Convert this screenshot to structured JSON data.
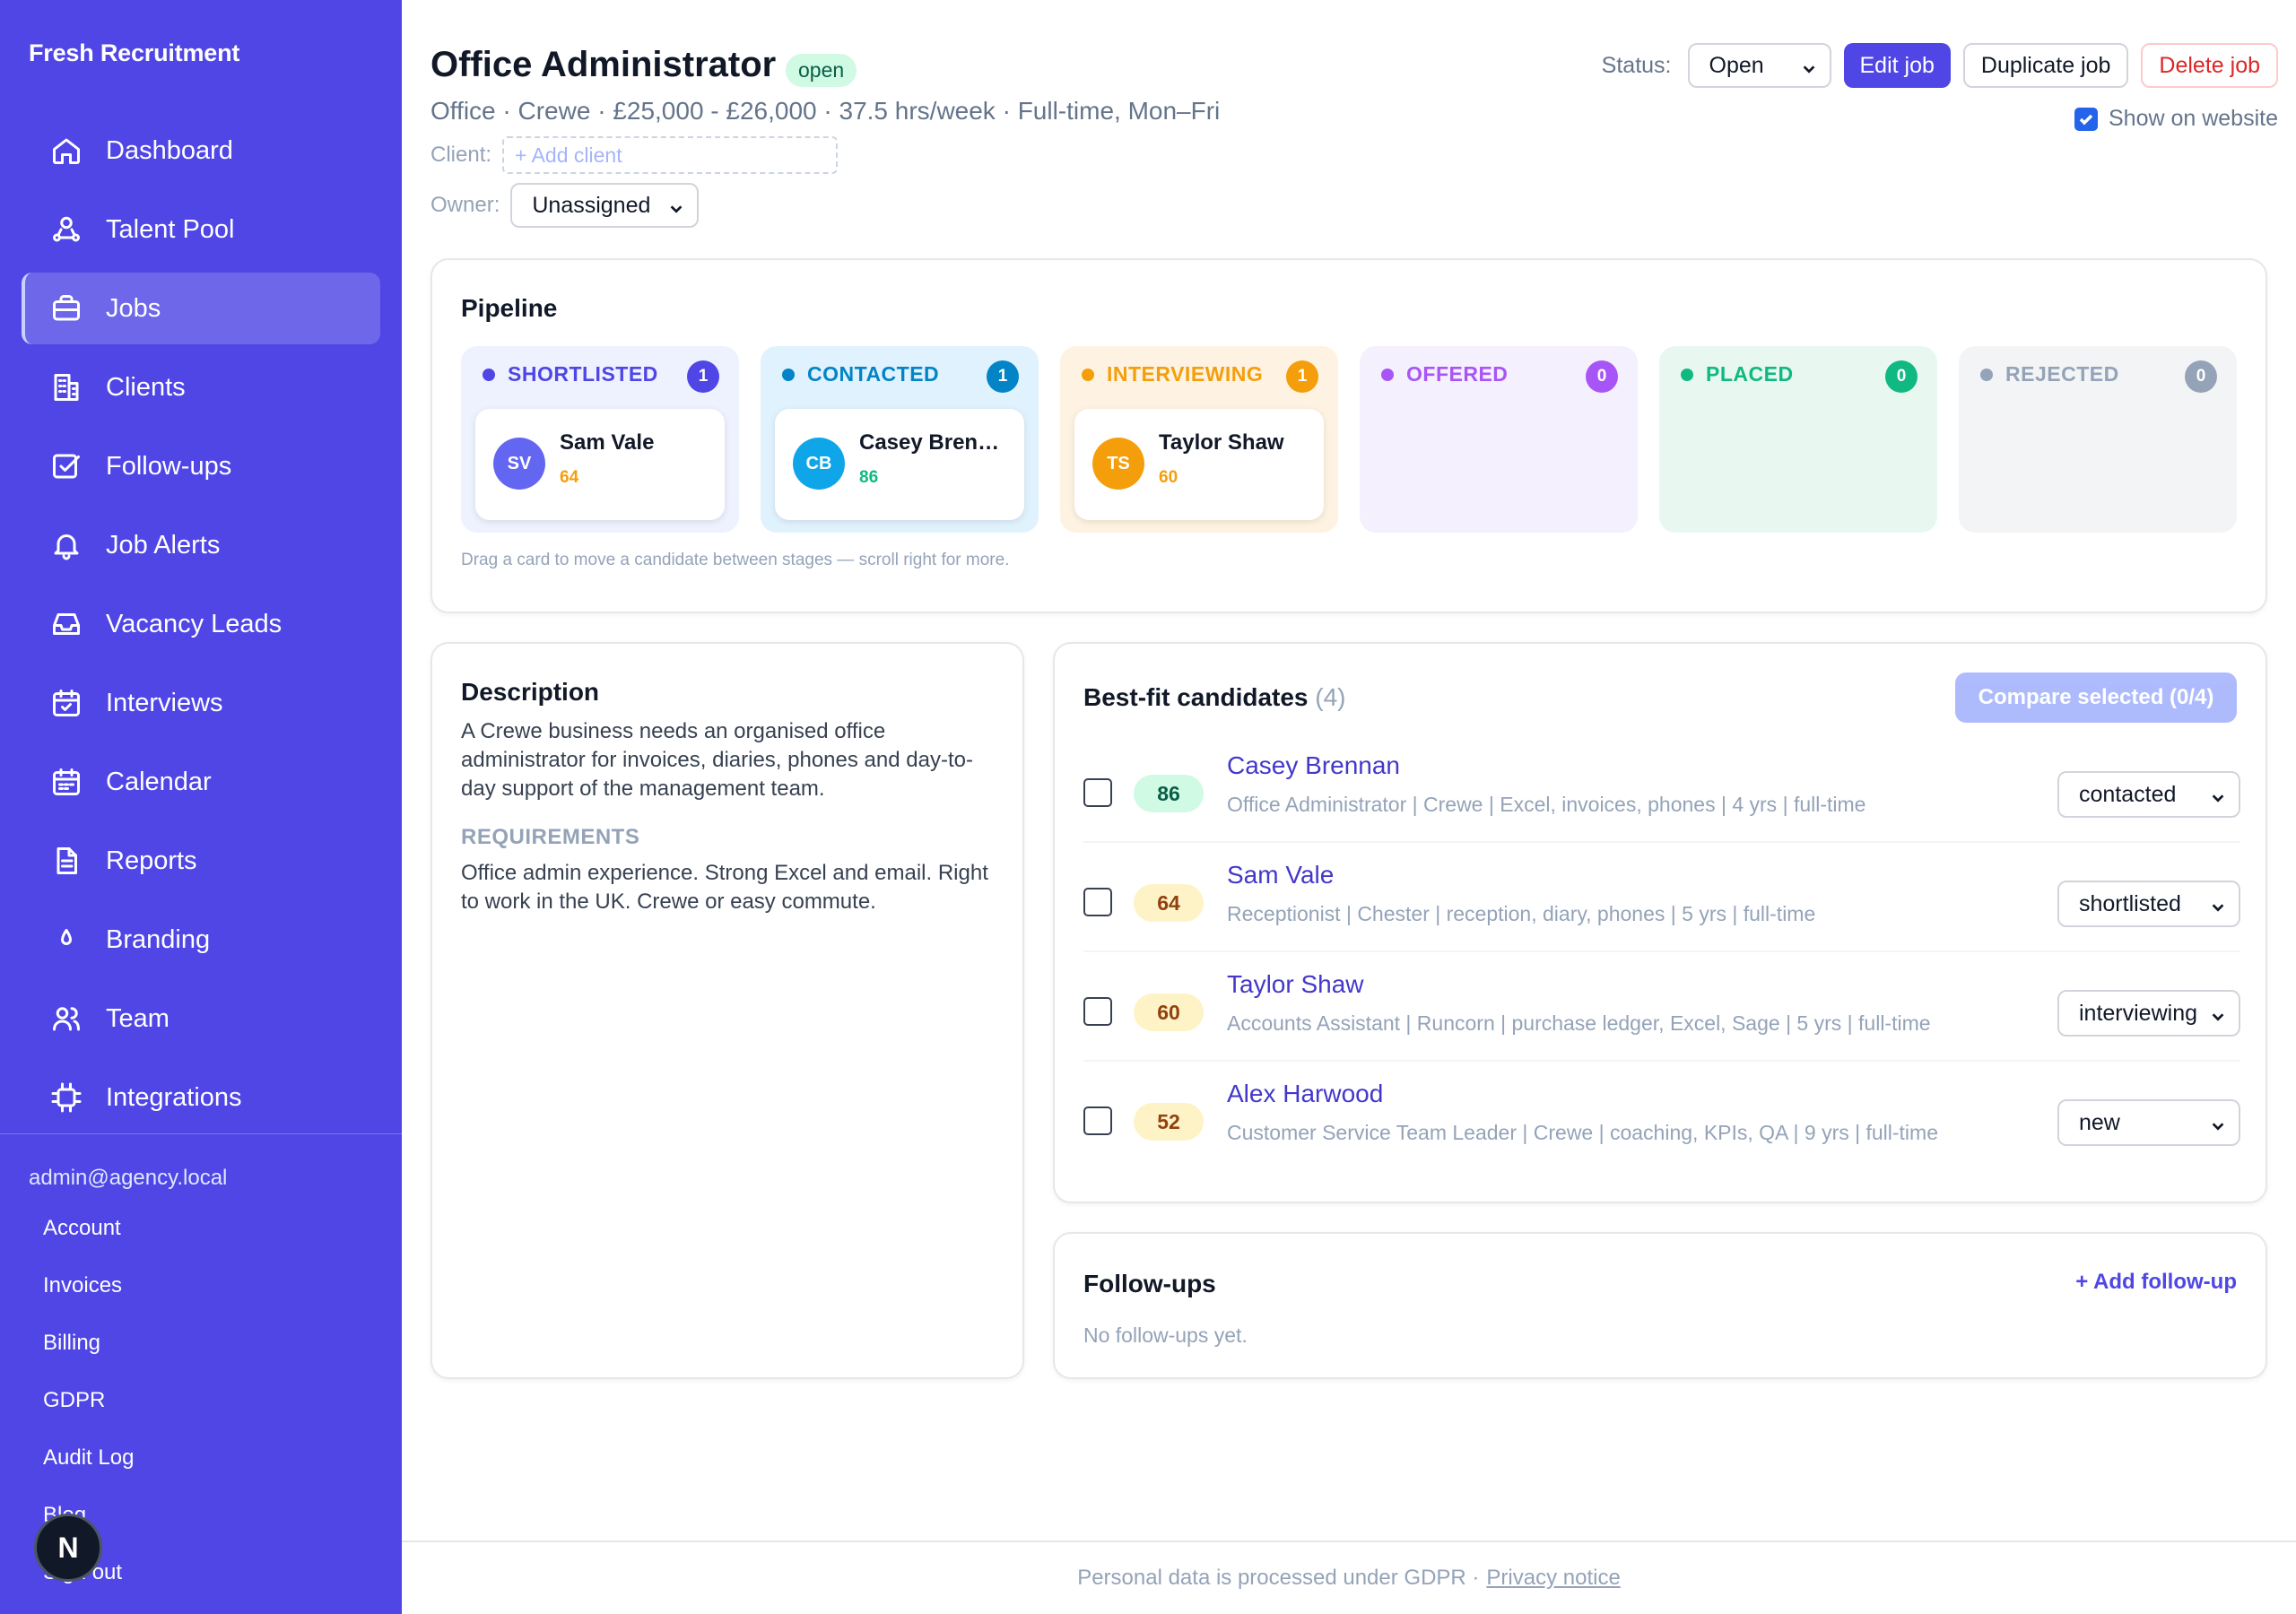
{
  "sidebar": {
    "brand": "Fresh Recruitment",
    "items": [
      {
        "label": "Dashboard",
        "icon": "home-icon"
      },
      {
        "label": "Talent Pool",
        "icon": "users-network-icon"
      },
      {
        "label": "Jobs",
        "icon": "briefcase-icon",
        "active": true
      },
      {
        "label": "Clients",
        "icon": "building-icon"
      },
      {
        "label": "Follow-ups",
        "icon": "checkbox-icon"
      },
      {
        "label": "Job Alerts",
        "icon": "bell-icon"
      },
      {
        "label": "Vacancy Leads",
        "icon": "inbox-icon"
      },
      {
        "label": "Interviews",
        "icon": "calendar-check-icon"
      },
      {
        "label": "Calendar",
        "icon": "calendar-icon"
      },
      {
        "label": "Reports",
        "icon": "document-icon"
      },
      {
        "label": "Branding",
        "icon": "droplet-icon"
      },
      {
        "label": "Team",
        "icon": "team-icon"
      },
      {
        "label": "Integrations",
        "icon": "chip-icon"
      }
    ],
    "email": "admin@agency.local",
    "links": [
      "Account",
      "Invoices",
      "Billing",
      "GDPR",
      "Audit Log",
      "Blog",
      "Sign out"
    ],
    "badge": "N"
  },
  "job": {
    "title": "Office Administrator",
    "status_badge": "open",
    "subtitle": "Office · Crewe · £25,000 - £26,000 · 37.5 hrs/week · Full-time, Mon–Fri",
    "client_label": "Client:",
    "client_placeholder": "+ Add client",
    "owner_label": "Owner:",
    "owner_value": "Unassigned"
  },
  "actions": {
    "status_label": "Status:",
    "status_value": "Open",
    "edit": "Edit job",
    "duplicate": "Duplicate job",
    "delete": "Delete job",
    "show_on_website": "Show on website",
    "show_on_website_checked": true
  },
  "pipeline": {
    "title": "Pipeline",
    "hint": "Drag a card to move a candidate between stages — scroll right for more.",
    "stages": [
      {
        "name": "SHORTLISTED",
        "count": "1",
        "color": "#4f46e5",
        "bg": "#eef2ff",
        "candidate": {
          "initials": "SV",
          "name": "Sam Vale",
          "score": "64",
          "avatar_color": "#6366f1",
          "score_color": "#f59e0b"
        }
      },
      {
        "name": "CONTACTED",
        "count": "1",
        "color": "#0284c7",
        "bg": "#e0f2fe",
        "candidate": {
          "initials": "CB",
          "name": "Casey Brennan",
          "score": "86",
          "avatar_color": "#0ea5e9",
          "score_color": "#10b981"
        }
      },
      {
        "name": "INTERVIEWING",
        "count": "1",
        "color": "#f59e0b",
        "bg": "#fef3e2",
        "candidate": {
          "initials": "TS",
          "name": "Taylor Shaw",
          "score": "60",
          "avatar_color": "#f59e0b",
          "score_color": "#f59e0b"
        }
      },
      {
        "name": "OFFERED",
        "count": "0",
        "color": "#a855f7",
        "bg": "#f5f0fd",
        "candidate": null
      },
      {
        "name": "PLACED",
        "count": "0",
        "color": "#10b981",
        "bg": "#e8f8f1",
        "candidate": null
      },
      {
        "name": "REJECTED",
        "count": "0",
        "color": "#94a3b8",
        "bg": "#f3f4f6",
        "candidate": null
      }
    ]
  },
  "description": {
    "title": "Description",
    "text": "A Crewe business needs an organised office administrator for invoices, diaries, phones and day-to-day support of the management team.",
    "requirements_label": "REQUIREMENTS",
    "requirements": "Office admin experience. Strong Excel and email. Right to work in the UK. Crewe or easy commute."
  },
  "bestfit": {
    "title": "Best-fit candidates",
    "count": "(4)",
    "compare": "Compare selected (0/4)",
    "candidates": [
      {
        "score": "86",
        "score_bg": "#d1fae5",
        "score_fg": "#065f46",
        "name": "Casey Brennan",
        "meta": "Office Administrator | Crewe | Excel, invoices, phones | 4 yrs | full-time",
        "stage": "contacted"
      },
      {
        "score": "64",
        "score_bg": "#fef3c7",
        "score_fg": "#92400e",
        "name": "Sam Vale",
        "meta": "Receptionist | Chester | reception, diary, phones | 5 yrs | full-time",
        "stage": "shortlisted"
      },
      {
        "score": "60",
        "score_bg": "#fef3c7",
        "score_fg": "#92400e",
        "name": "Taylor Shaw",
        "meta": "Accounts Assistant | Runcorn | purchase ledger, Excel, Sage | 5 yrs | full-time",
        "stage": "interviewing"
      },
      {
        "score": "52",
        "score_bg": "#fef3c7",
        "score_fg": "#92400e",
        "name": "Alex Harwood",
        "meta": "Customer Service Team Leader | Crewe | coaching, KPIs, QA | 9 yrs | full-time",
        "stage": "new"
      }
    ]
  },
  "followups": {
    "title": "Follow-ups",
    "add": "+ Add follow-up",
    "empty": "No follow-ups yet."
  },
  "footer": {
    "text": "Personal data is processed under GDPR ·",
    "link": "Privacy notice"
  }
}
